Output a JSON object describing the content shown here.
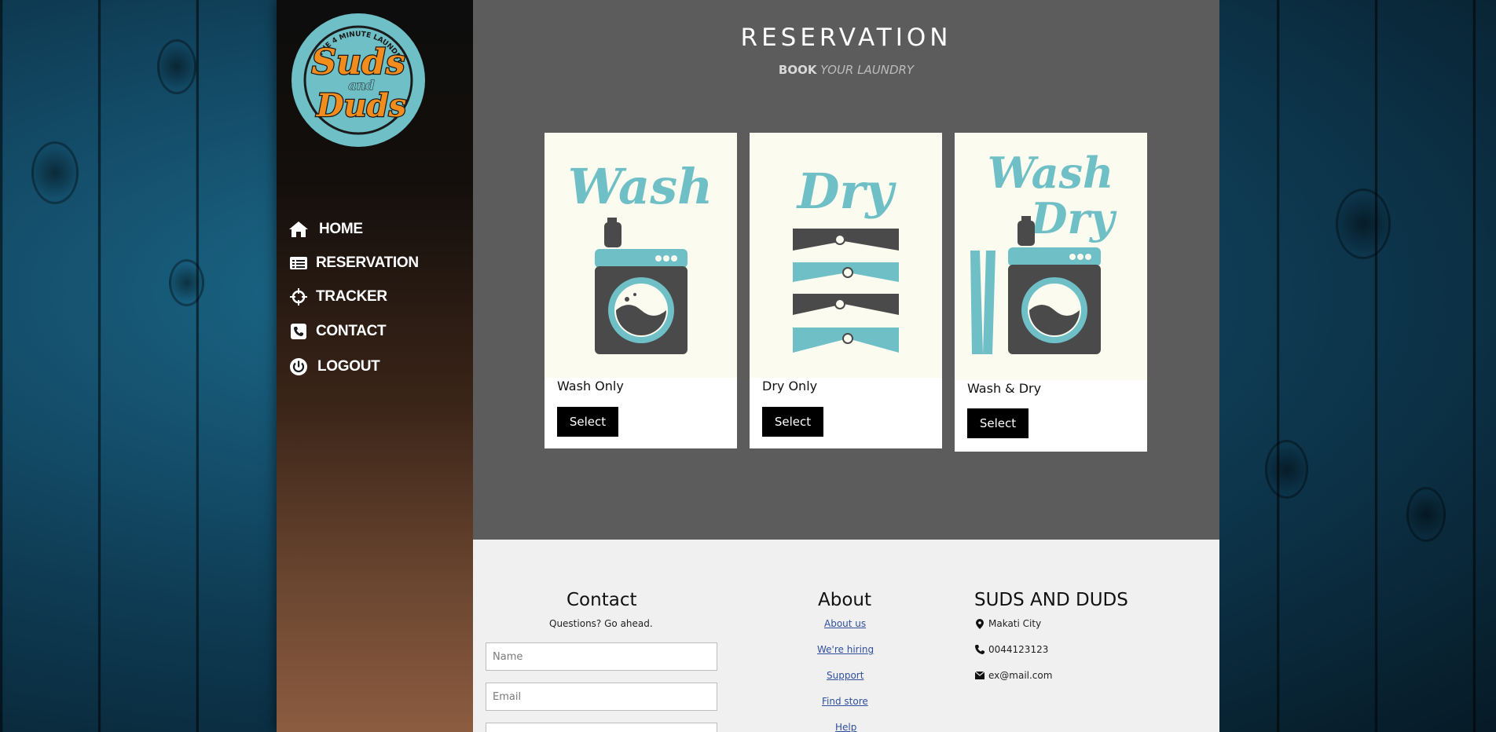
{
  "brand": {
    "logo_top_text": "THE 4 MINUTE LAUNDRY",
    "logo_line1": "Suds",
    "logo_line2": "and",
    "logo_line3": "Duds"
  },
  "nav": {
    "items": [
      {
        "label": "HOME",
        "icon": "home-icon"
      },
      {
        "label": "RESERVATION",
        "icon": "list-icon"
      },
      {
        "label": "TRACKER",
        "icon": "crosshair-icon"
      },
      {
        "label": "CONTACT",
        "icon": "phone-icon"
      },
      {
        "label": "LOGOUT",
        "icon": "power-icon"
      }
    ]
  },
  "header": {
    "title": "RESERVATION",
    "subtitle_bold": "BOOK",
    "subtitle_italic": "YOUR LAUNDRY"
  },
  "services": [
    {
      "art_text": "Wash",
      "name": "Wash Only",
      "button": "Select"
    },
    {
      "art_text": "Dry",
      "name": "Dry Only",
      "button": "Select"
    },
    {
      "art_text1": "Wash",
      "art_text2": "Dry",
      "name": "Wash & Dry",
      "button": "Select"
    }
  ],
  "footer": {
    "contact": {
      "heading": "Contact",
      "subtext": "Questions? Go ahead.",
      "name_placeholder": "Name",
      "email_placeholder": "Email"
    },
    "about": {
      "heading": "About",
      "links": [
        "About us",
        "We're hiring",
        "Support",
        "Find store",
        "Help"
      ]
    },
    "company": {
      "heading": "SUDS AND DUDS",
      "location": "Makati City",
      "phone": "0044123123",
      "email": "ex@mail.com"
    }
  },
  "colors": {
    "accent_teal": "#6fbfc6",
    "accent_orange": "#f28c1c",
    "main_panel": "#5c5c5c",
    "footer_bg": "#f0f0f0"
  }
}
